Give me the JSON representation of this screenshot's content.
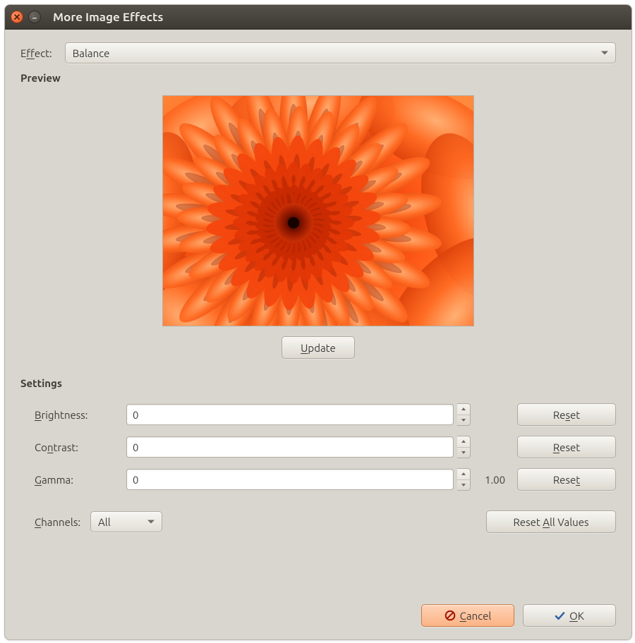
{
  "window": {
    "title": "More Image Effects"
  },
  "effect": {
    "label_pre": "E",
    "label_u": "f",
    "label_post": "fect:",
    "value": "Balance",
    "triangle_icon": "dropdown-triangle"
  },
  "preview": {
    "heading": "Preview",
    "update_pre": "",
    "update_u": "U",
    "update_post": "pdate"
  },
  "settings": {
    "heading": "Settings",
    "brightness": {
      "label_u": "B",
      "label_post": "rightness:",
      "value": "0",
      "reset_pre": "Re",
      "reset_u": "s",
      "reset_post": "et"
    },
    "contrast": {
      "label_pre": "Co",
      "label_u": "n",
      "label_post": "trast:",
      "value": "0",
      "reset_pre": "",
      "reset_u": "R",
      "reset_post": "eset"
    },
    "gamma": {
      "label_u": "G",
      "label_post": "amma:",
      "value": "0",
      "display": "1.00",
      "reset_pre": "Rese",
      "reset_u": "t",
      "reset_post": ""
    },
    "channels": {
      "label_u": "C",
      "label_post": "hannels:",
      "value": "All"
    },
    "reset_all": {
      "pre": "Reset ",
      "u": "A",
      "post": "ll Values"
    }
  },
  "footer": {
    "cancel": {
      "u": "C",
      "post": "ancel"
    },
    "ok": {
      "u": "O",
      "post": "K"
    }
  }
}
